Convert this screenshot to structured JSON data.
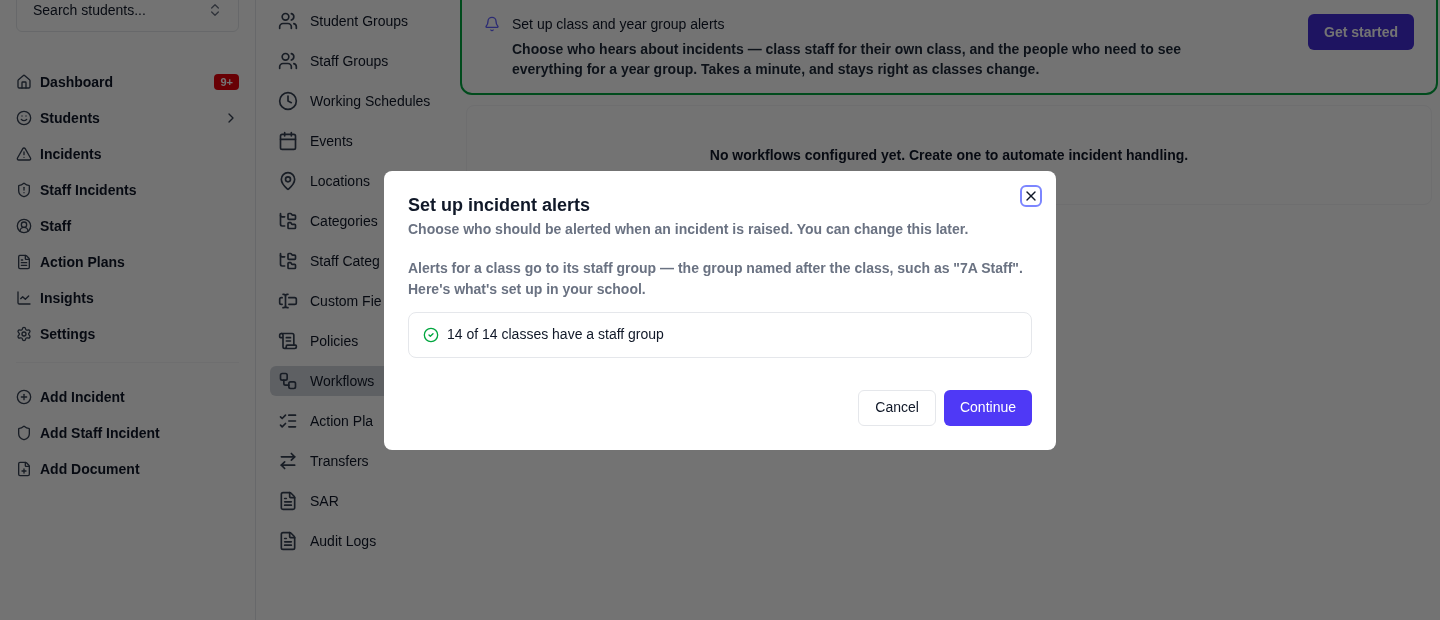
{
  "sidebar": {
    "search": {
      "placeholder": "Search students..."
    },
    "nav": [
      {
        "label": "Dashboard",
        "badge": "9+",
        "expandable": false
      },
      {
        "label": "Students",
        "expandable": true
      },
      {
        "label": "Incidents",
        "expandable": false
      },
      {
        "label": "Staff Incidents",
        "expandable": false
      },
      {
        "label": "Staff",
        "expandable": false
      },
      {
        "label": "Action Plans",
        "expandable": false
      },
      {
        "label": "Insights",
        "expandable": false
      },
      {
        "label": "Settings",
        "expandable": false
      }
    ],
    "actions": [
      {
        "label": "Add Incident"
      },
      {
        "label": "Add Staff Incident"
      },
      {
        "label": "Add Document"
      }
    ]
  },
  "settings_nav": [
    {
      "label": "Student Groups",
      "selected": false
    },
    {
      "label": "Staff Groups",
      "selected": false
    },
    {
      "label": "Working Schedules",
      "selected": false
    },
    {
      "label": "Events",
      "selected": false
    },
    {
      "label": "Locations",
      "selected": false
    },
    {
      "label": "Categories",
      "selected": false
    },
    {
      "label": "Staff Categ",
      "selected": false
    },
    {
      "label": "Custom Fie",
      "selected": false
    },
    {
      "label": "Policies",
      "selected": false
    },
    {
      "label": "Workflows",
      "selected": true
    },
    {
      "label": "Action Pla",
      "selected": false
    },
    {
      "label": "Transfers",
      "selected": false
    },
    {
      "label": "SAR",
      "selected": false
    },
    {
      "label": "Audit Logs",
      "selected": false
    }
  ],
  "banner": {
    "title": "Set up class and year group alerts",
    "text": "Choose who hears about incidents — class staff for their own class, and the people who need to see everything for a year group. Takes a minute, and stays right as classes change.",
    "button": "Get started"
  },
  "empty_state": {
    "text": "No workflows configured yet. Create one to automate incident handling."
  },
  "dialog": {
    "title": "Set up incident alerts",
    "description": "Choose who should be alerted when an incident is raised. You can change this later.",
    "body": "Alerts for a class go to its staff group — the group named after the class, such as \"7A Staff\". Here's what's set up in your school.",
    "status": {
      "text": "14 of 14 classes have a staff group",
      "ok": true
    },
    "buttons": {
      "cancel": "Cancel",
      "confirm": "Continue"
    }
  }
}
